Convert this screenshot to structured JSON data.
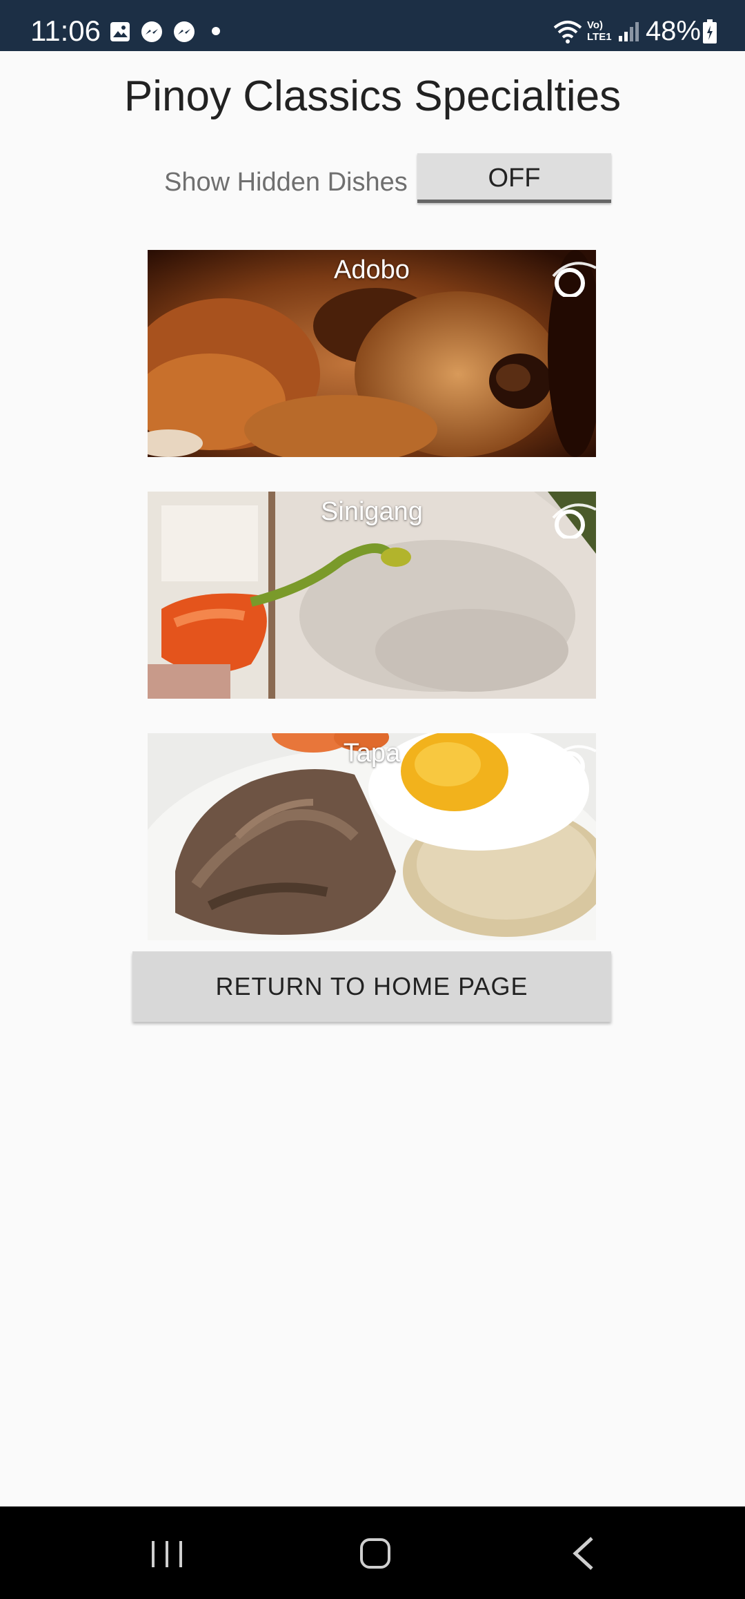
{
  "status_bar": {
    "time": "11:06",
    "notifications": [
      "gallery-icon",
      "messenger-icon",
      "messenger-icon",
      "dot-icon"
    ],
    "network": "Vo) LTE1",
    "battery": "48%"
  },
  "page": {
    "title": "Pinoy Classics Specialties"
  },
  "toggle": {
    "label": "Show Hidden Dishes",
    "state": "OFF"
  },
  "dishes": [
    {
      "name": "Adobo",
      "icon": "hide-icon"
    },
    {
      "name": "Sinigang",
      "icon": "hide-icon"
    },
    {
      "name": "Tapa",
      "icon": "hide-icon"
    }
  ],
  "actions": {
    "return_label": "RETURN TO HOME PAGE"
  },
  "nav": {
    "buttons": [
      "recents-icon",
      "home-icon",
      "back-icon"
    ]
  },
  "colors": {
    "status_bar": "#1c2f45",
    "background": "#fafafa",
    "button": "#d8d8d8"
  }
}
